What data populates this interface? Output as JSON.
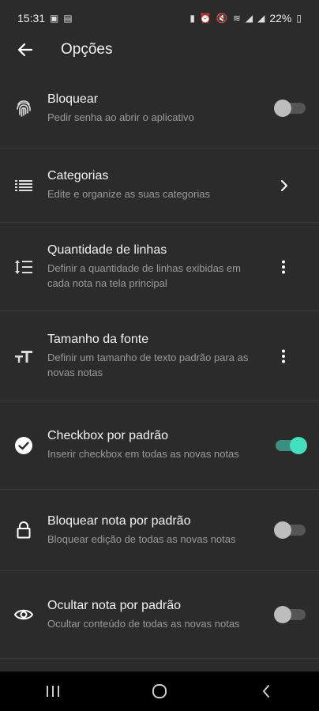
{
  "status": {
    "time": "15:31",
    "battery": "22%"
  },
  "appbar": {
    "title": "Opções"
  },
  "settings": [
    {
      "title": "Bloquear",
      "subtitle": "Pedir senha ao abrir o aplicativo",
      "icon": "fingerprint-icon",
      "control": "switch",
      "on": false
    },
    {
      "title": "Categorias",
      "subtitle": "Edite e organize as suas categorias",
      "icon": "list-icon",
      "control": "chevron"
    },
    {
      "title": "Quantidade de linhas",
      "subtitle": "Definir a quantidade de linhas exibidas em cada nota na tela principal",
      "icon": "line-spacing-icon",
      "control": "menu"
    },
    {
      "title": "Tamanho da fonte",
      "subtitle": "Definir um tamanho de texto padrão para as novas notas",
      "icon": "text-size-icon",
      "control": "menu"
    },
    {
      "title": "Checkbox por padrão",
      "subtitle": "Inserir checkbox em todas as novas notas",
      "icon": "check-circle-icon",
      "control": "switch",
      "on": true
    },
    {
      "title": "Bloquear nota por padrão",
      "subtitle": "Bloquear edição de todas as novas notas",
      "icon": "lock-icon",
      "control": "switch",
      "on": false
    },
    {
      "title": "Ocultar nota por padrão",
      "subtitle": "Ocultar conteúdo de todas as novas notas",
      "icon": "eye-icon",
      "control": "switch",
      "on": false
    }
  ]
}
